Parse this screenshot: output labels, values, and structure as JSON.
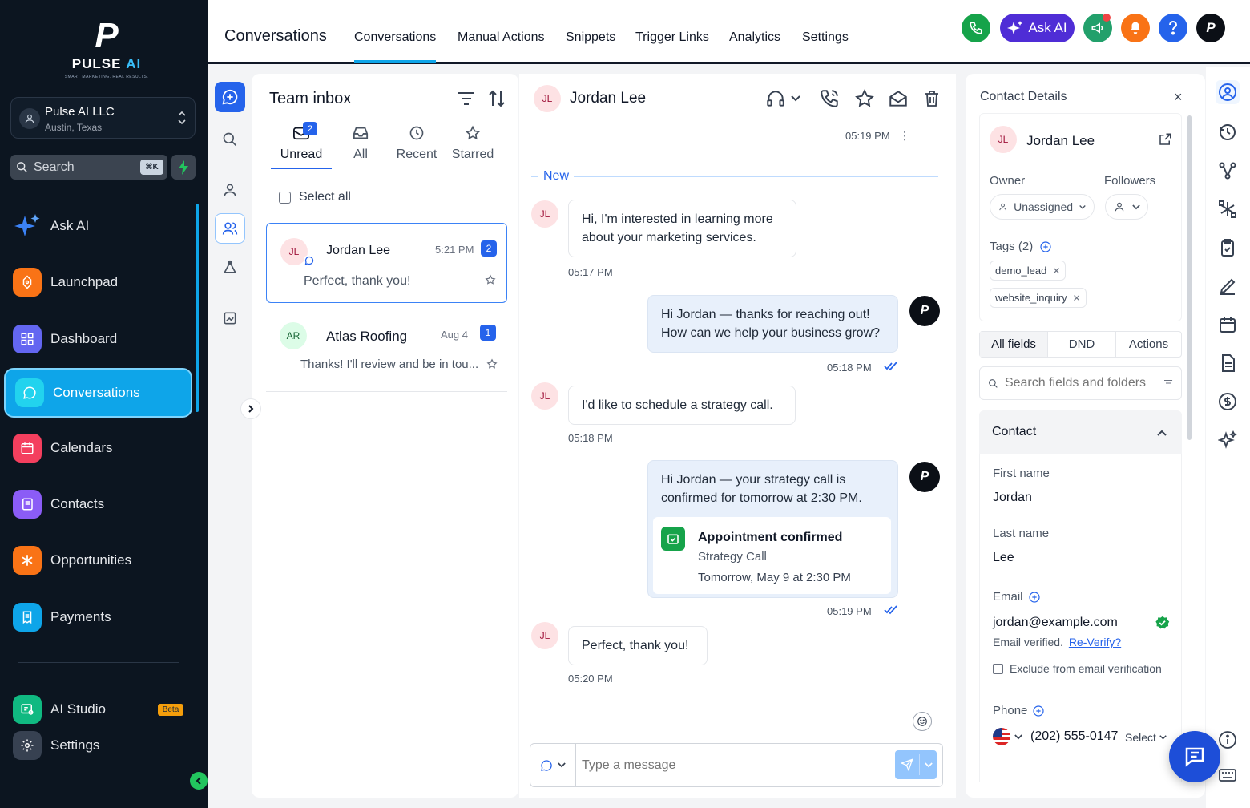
{
  "brand": {
    "mark": "P",
    "name_a": "PULSE ",
    "name_b": "AI",
    "tagline": "SMART MARKETING. REAL RESULTS."
  },
  "account": {
    "name": "Pulse AI LLC",
    "location": "Austin, Texas"
  },
  "sidebar": {
    "search_label": "Search",
    "search_shortcut": "⌘K",
    "items": [
      {
        "label": "Ask AI"
      },
      {
        "label": "Launchpad"
      },
      {
        "label": "Dashboard"
      },
      {
        "label": "Conversations"
      },
      {
        "label": "Calendars"
      },
      {
        "label": "Contacts"
      },
      {
        "label": "Opportunities"
      },
      {
        "label": "Payments"
      }
    ],
    "bottom": [
      {
        "label": "AI Studio",
        "badge": "Beta"
      },
      {
        "label": "Settings"
      }
    ]
  },
  "header": {
    "title": "Conversations",
    "tabs": [
      "Conversations",
      "Manual Actions",
      "Snippets",
      "Trigger Links",
      "Analytics",
      "Settings"
    ],
    "ask_ai": "Ask AI"
  },
  "inbox": {
    "title": "Team inbox",
    "tabs": [
      "Unread",
      "All",
      "Recent",
      "Starred"
    ],
    "unread_badge": "2",
    "select_all": "Select all",
    "conversations": [
      {
        "initials": "JL",
        "name": "Jordan Lee",
        "time": "5:21 PM",
        "count": "2",
        "preview": "Perfect, thank you!"
      },
      {
        "initials": "AR",
        "name": "Atlas Roofing",
        "time": "Aug 4",
        "count": "1",
        "preview": "Thanks! I'll review and be in tou..."
      }
    ]
  },
  "chat": {
    "contact_initials": "JL",
    "contact_name": "Jordan Lee",
    "top_time": "05:19 PM",
    "new_label": "New",
    "messages": [
      {
        "dir": "in",
        "text_1": "Hi, I'm interested in learning more",
        "text_2": "about your marketing services.",
        "time": "05:17 PM"
      },
      {
        "dir": "out",
        "text_1": "Hi Jordan — thanks for reaching out!",
        "text_2": "How can we help your business grow?",
        "time": "05:18 PM"
      },
      {
        "dir": "in",
        "text_1": "I'd like to schedule a strategy call.",
        "time": "05:18 PM"
      },
      {
        "dir": "out",
        "text_1": "Hi Jordan — your strategy call is",
        "text_2": "confirmed for tomorrow at 2:30 PM.",
        "time": "05:19 PM",
        "appointment": {
          "title": "Appointment confirmed",
          "type": "Strategy Call",
          "when": "Tomorrow, May 9 at 2:30 PM"
        }
      },
      {
        "dir": "in",
        "text_1": "Perfect, thank you!",
        "time": "05:20 PM"
      }
    ],
    "composer_placeholder": "Type a message"
  },
  "details": {
    "title": "Contact Details",
    "contact_initials": "JL",
    "contact_name": "Jordan Lee",
    "owner_label": "Owner",
    "owner_value": "Unassigned",
    "followers_label": "Followers",
    "tags_label": "Tags (2)",
    "tags": [
      "demo_lead",
      "website_inquiry"
    ],
    "tabs": [
      "All fields",
      "DND",
      "Actions"
    ],
    "search_placeholder": "Search fields and folders",
    "section": "Contact",
    "first_name_label": "First name",
    "first_name": "Jordan",
    "last_name_label": "Last name",
    "last_name": "Lee",
    "email_label": "Email",
    "email": "jordan@example.com",
    "email_verified": "Email verified.",
    "reverify": "Re-Verify?",
    "exclude_label": "Exclude from email verification",
    "phone_label": "Phone",
    "phone": "(202) 555-0147",
    "phone_type": "Select"
  },
  "colors": {
    "accent": "#0ea5e9",
    "sidebar_bg": "#0c1520",
    "badge_blue": "#2563eb",
    "ask_ai_purple": "#4f2dd6",
    "phone_green": "#16a34a"
  }
}
